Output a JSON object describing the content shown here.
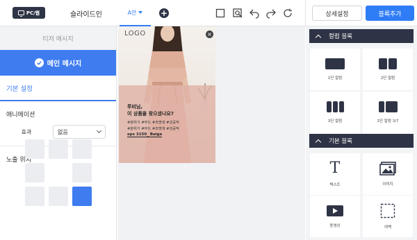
{
  "topbar": {
    "device_label": "PC/웹",
    "slide_label": "슬라이드인",
    "tab_label": "A안",
    "add_label": "+",
    "detail_button": "상세설정",
    "add_block_button": "블록추가"
  },
  "left": {
    "teaser_label": "티저 메시지",
    "main_message_label": "메인 메시지",
    "basic_settings": "기본 설정",
    "animation_title": "애니메이션",
    "effect_label": "효과",
    "effect_value": "없음",
    "position_title": "노출 위치"
  },
  "popup": {
    "logo": "LOGO",
    "close_symbol": "×",
    "line1": "루비님,",
    "line2": "이 상품을 찾으셨나요?",
    "tags": "#분위기 #무드 #조명색 #성공적",
    "tags2": "#분위기 #무드 #조명색 #성공적",
    "code": "ops 3150_ Beige"
  },
  "right": {
    "column_block": "컬럼 블록",
    "basic_block": "기본 블록",
    "col1": "1단 칼럼",
    "col2": "2단 칼럼",
    "col3": "3단 칼럼",
    "col37": "2단 칼럼 3/7",
    "text": "텍스트",
    "text_glyph": "T",
    "image": "이미지",
    "video": "동영상",
    "blank": "여백"
  },
  "colors": {
    "accent": "#3e7cf0",
    "dark": "#2e3446"
  }
}
